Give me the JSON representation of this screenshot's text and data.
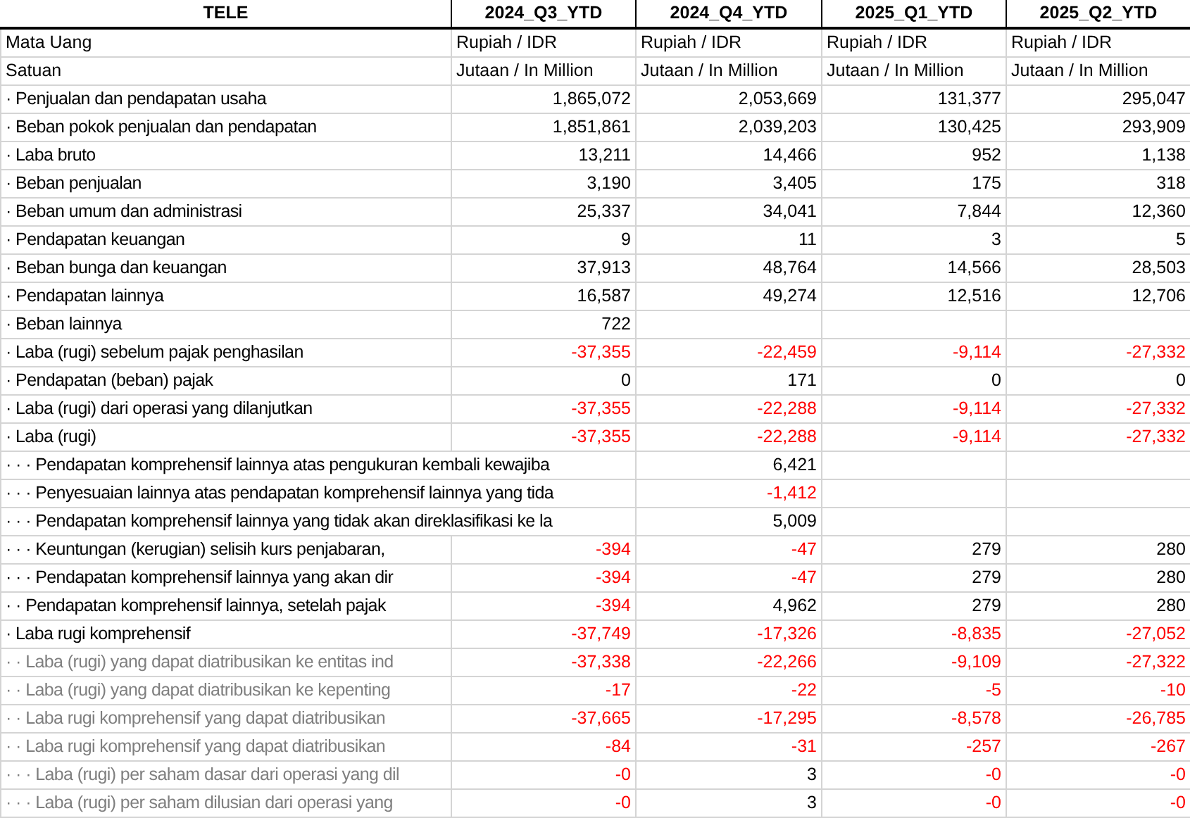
{
  "table": {
    "corner": "TELE",
    "columns": [
      "2024_Q3_YTD",
      "2024_Q4_YTD",
      "2025_Q1_YTD",
      "2025_Q2_YTD"
    ],
    "meta_rows": [
      {
        "label": "Mata Uang",
        "values": [
          "Rupiah / IDR",
          "Rupiah / IDR",
          "Rupiah / IDR",
          "Rupiah / IDR"
        ]
      },
      {
        "label": "Satuan",
        "values": [
          "Jutaan / In Million",
          "Jutaan / In Million",
          "Jutaan / In Million",
          "Jutaan / In Million"
        ]
      }
    ],
    "rows": [
      {
        "label": "· Penjualan dan pendapatan usaha",
        "muted": false,
        "cells": [
          {
            "text": "1,865,072",
            "negative": false
          },
          {
            "text": "2,053,669",
            "negative": false
          },
          {
            "text": "131,377",
            "negative": false
          },
          {
            "text": "295,047",
            "negative": false
          }
        ]
      },
      {
        "label": "· Beban pokok penjualan dan pendapatan",
        "muted": false,
        "cells": [
          {
            "text": "1,851,861",
            "negative": false
          },
          {
            "text": "2,039,203",
            "negative": false
          },
          {
            "text": "130,425",
            "negative": false
          },
          {
            "text": "293,909",
            "negative": false
          }
        ]
      },
      {
        "label": "· Laba bruto",
        "muted": false,
        "cells": [
          {
            "text": "13,211",
            "negative": false
          },
          {
            "text": "14,466",
            "negative": false
          },
          {
            "text": "952",
            "negative": false
          },
          {
            "text": "1,138",
            "negative": false
          }
        ]
      },
      {
        "label": "· Beban penjualan",
        "muted": false,
        "cells": [
          {
            "text": "3,190",
            "negative": false
          },
          {
            "text": "3,405",
            "negative": false
          },
          {
            "text": "175",
            "negative": false
          },
          {
            "text": "318",
            "negative": false
          }
        ]
      },
      {
        "label": "· Beban umum dan administrasi",
        "muted": false,
        "cells": [
          {
            "text": "25,337",
            "negative": false
          },
          {
            "text": "34,041",
            "negative": false
          },
          {
            "text": "7,844",
            "negative": false
          },
          {
            "text": "12,360",
            "negative": false
          }
        ]
      },
      {
        "label": "· Pendapatan keuangan",
        "muted": false,
        "cells": [
          {
            "text": "9",
            "negative": false
          },
          {
            "text": "11",
            "negative": false
          },
          {
            "text": "3",
            "negative": false
          },
          {
            "text": "5",
            "negative": false
          }
        ]
      },
      {
        "label": "· Beban bunga dan keuangan",
        "muted": false,
        "cells": [
          {
            "text": "37,913",
            "negative": false
          },
          {
            "text": "48,764",
            "negative": false
          },
          {
            "text": "14,566",
            "negative": false
          },
          {
            "text": "28,503",
            "negative": false
          }
        ]
      },
      {
        "label": "· Pendapatan lainnya",
        "muted": false,
        "cells": [
          {
            "text": "16,587",
            "negative": false
          },
          {
            "text": "49,274",
            "negative": false
          },
          {
            "text": "12,516",
            "negative": false
          },
          {
            "text": "12,706",
            "negative": false
          }
        ]
      },
      {
        "label": "· Beban lainnya",
        "muted": false,
        "cells": [
          {
            "text": "722",
            "negative": false
          },
          null,
          null,
          null
        ]
      },
      {
        "label": "· Laba (rugi) sebelum pajak penghasilan",
        "muted": false,
        "cells": [
          {
            "text": "-37,355",
            "negative": true
          },
          {
            "text": "-22,459",
            "negative": true
          },
          {
            "text": "-9,114",
            "negative": true
          },
          {
            "text": "-27,332",
            "negative": true
          }
        ]
      },
      {
        "label": "· Pendapatan (beban) pajak",
        "muted": false,
        "cells": [
          {
            "text": "0",
            "negative": false
          },
          {
            "text": "171",
            "negative": false
          },
          {
            "text": "0",
            "negative": false
          },
          {
            "text": "0",
            "negative": false
          }
        ]
      },
      {
        "label": "· Laba (rugi) dari operasi yang dilanjutkan",
        "muted": false,
        "cells": [
          {
            "text": "-37,355",
            "negative": true
          },
          {
            "text": "-22,288",
            "negative": true
          },
          {
            "text": "-9,114",
            "negative": true
          },
          {
            "text": "-27,332",
            "negative": true
          }
        ]
      },
      {
        "label": "· Laba (rugi)",
        "muted": false,
        "cells": [
          {
            "text": "-37,355",
            "negative": true
          },
          {
            "text": "-22,288",
            "negative": true
          },
          {
            "text": "-9,114",
            "negative": true
          },
          {
            "text": "-27,332",
            "negative": true
          }
        ]
      },
      {
        "label": "· · · Pendapatan komprehensif lainnya atas pengukuran kembali kewajiba",
        "muted": false,
        "cells": [
          null,
          {
            "text": "6,421",
            "negative": false
          },
          null,
          null
        ]
      },
      {
        "label": "· · · Penyesuaian lainnya atas pendapatan komprehensif lainnya yang tida",
        "muted": false,
        "cells": [
          null,
          {
            "text": "-1,412",
            "negative": true
          },
          null,
          null
        ]
      },
      {
        "label": "· · · Pendapatan komprehensif lainnya yang tidak akan direklasifikasi ke la",
        "muted": false,
        "cells": [
          null,
          {
            "text": "5,009",
            "negative": false
          },
          null,
          null
        ]
      },
      {
        "label": "· · · Keuntungan (kerugian) selisih kurs penjabaran,",
        "muted": false,
        "cells": [
          {
            "text": "-394",
            "negative": true
          },
          {
            "text": "-47",
            "negative": true
          },
          {
            "text": "279",
            "negative": false
          },
          {
            "text": "280",
            "negative": false
          }
        ]
      },
      {
        "label": "· · · Pendapatan komprehensif lainnya yang akan dir",
        "muted": false,
        "cells": [
          {
            "text": "-394",
            "negative": true
          },
          {
            "text": "-47",
            "negative": true
          },
          {
            "text": "279",
            "negative": false
          },
          {
            "text": "280",
            "negative": false
          }
        ]
      },
      {
        "label": "· · Pendapatan komprehensif lainnya, setelah pajak",
        "muted": false,
        "cells": [
          {
            "text": "-394",
            "negative": true
          },
          {
            "text": "4,962",
            "negative": false
          },
          {
            "text": "279",
            "negative": false
          },
          {
            "text": "280",
            "negative": false
          }
        ]
      },
      {
        "label": "· Laba rugi komprehensif",
        "muted": false,
        "cells": [
          {
            "text": "-37,749",
            "negative": true
          },
          {
            "text": "-17,326",
            "negative": true
          },
          {
            "text": "-8,835",
            "negative": true
          },
          {
            "text": "-27,052",
            "negative": true
          }
        ]
      },
      {
        "label": "· · Laba (rugi) yang dapat diatribusikan ke entitas ind",
        "muted": true,
        "cells": [
          {
            "text": "-37,338",
            "negative": true
          },
          {
            "text": "-22,266",
            "negative": true
          },
          {
            "text": "-9,109",
            "negative": true
          },
          {
            "text": "-27,322",
            "negative": true
          }
        ]
      },
      {
        "label": "· · Laba (rugi) yang dapat diatribusikan ke kepenting",
        "muted": true,
        "cells": [
          {
            "text": "-17",
            "negative": true
          },
          {
            "text": "-22",
            "negative": true
          },
          {
            "text": "-5",
            "negative": true
          },
          {
            "text": "-10",
            "negative": true
          }
        ]
      },
      {
        "label": "· · Laba rugi komprehensif yang dapat diatribusikan",
        "muted": true,
        "cells": [
          {
            "text": "-37,665",
            "negative": true
          },
          {
            "text": "-17,295",
            "negative": true
          },
          {
            "text": "-8,578",
            "negative": true
          },
          {
            "text": "-26,785",
            "negative": true
          }
        ]
      },
      {
        "label": "· · Laba rugi komprehensif yang dapat diatribusikan",
        "muted": true,
        "cells": [
          {
            "text": "-84",
            "negative": true
          },
          {
            "text": "-31",
            "negative": true
          },
          {
            "text": "-257",
            "negative": true
          },
          {
            "text": "-267",
            "negative": true
          }
        ]
      },
      {
        "label": "· · · Laba (rugi) per saham dasar dari operasi yang dil",
        "muted": true,
        "cells": [
          {
            "text": "-0",
            "negative": true
          },
          {
            "text": "3",
            "negative": false
          },
          {
            "text": "-0",
            "negative": true
          },
          {
            "text": "-0",
            "negative": true
          }
        ]
      },
      {
        "label": "· · · Laba (rugi) per saham dilusian dari operasi yang",
        "muted": true,
        "cells": [
          {
            "text": "-0",
            "negative": true
          },
          {
            "text": "3",
            "negative": false
          },
          {
            "text": "-0",
            "negative": true
          },
          {
            "text": "-0",
            "negative": true
          }
        ]
      }
    ]
  }
}
